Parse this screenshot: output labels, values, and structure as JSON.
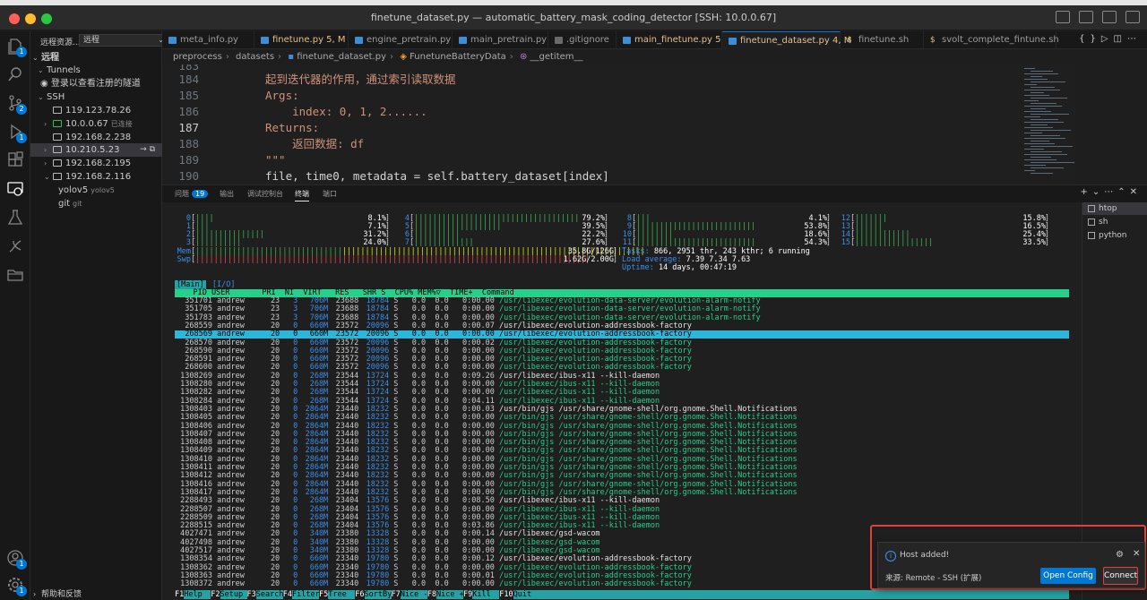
{
  "window": {
    "title": "finetune_dataset.py — automatic_battery_mask_coding_detector [SSH: 10.0.0.67]"
  },
  "activity": {
    "badges": {
      "scm": "2",
      "debug": "1",
      "accounts": "1"
    }
  },
  "sidebar": {
    "title": "远程资源...",
    "select_value": "远程",
    "section_remote": "远程",
    "tunnels_label": "Tunnels",
    "tunnels_login": "登录以查看注册的隧道",
    "ssh_label": "SSH",
    "hosts": [
      {
        "name": "119.123.78.26",
        "sub": ""
      },
      {
        "name": "10.0.0.67",
        "sub": "已连接"
      },
      {
        "name": "192.168.2.238",
        "sub": ""
      },
      {
        "name": "10.210.5.23",
        "sub": ""
      },
      {
        "name": "192.168.2.195",
        "sub": ""
      },
      {
        "name": "192.168.2.116",
        "sub": ""
      }
    ],
    "children": [
      {
        "name": "yolov5",
        "sub": "yolov5"
      },
      {
        "name": "git",
        "sub": "git"
      }
    ],
    "help": "帮助和反馈"
  },
  "tabs": [
    {
      "label": "meta_info.py",
      "status": ""
    },
    {
      "label": "finetune.py",
      "status": "5, M"
    },
    {
      "label": "engine_pretrain.py",
      "status": ""
    },
    {
      "label": "main_pretrain.py",
      "status": ""
    },
    {
      "label": ".gitignore",
      "status": ""
    },
    {
      "label": "main_finetune.py",
      "status": "5"
    },
    {
      "label": "finetune_dataset.py",
      "status": "4, M"
    },
    {
      "label": "finetune.sh",
      "status": ""
    },
    {
      "label": "svolt_complete_fintune.sh",
      "status": ""
    }
  ],
  "breadcrumb": [
    "preprocess",
    "datasets",
    "finetune_dataset.py",
    "FunetuneBatteryData",
    "__getitem__"
  ],
  "code": [
    {
      "ln": "184",
      "text": "起到迭代器的作用，通过索引读取数据",
      "kind": "str"
    },
    {
      "ln": "185",
      "text": "Args:",
      "kind": "str"
    },
    {
      "ln": "186",
      "text": "    index: 0, 1, 2......",
      "kind": "str"
    },
    {
      "ln": "187",
      "text": "Returns:",
      "kind": "str"
    },
    {
      "ln": "188",
      "text": "    返回数据: df",
      "kind": "str"
    },
    {
      "ln": "189",
      "text": "\"\"\"",
      "kind": "str"
    },
    {
      "ln": "190",
      "text": "file, time0, metadata = self.battery_dataset[index]",
      "kind": "code"
    }
  ],
  "panel": {
    "tabs": [
      "问题",
      "输出",
      "调试控制台",
      "终端",
      "端口"
    ],
    "problems_count": "19",
    "terminals": [
      "htop",
      "sh",
      "python"
    ]
  },
  "htop": {
    "cpus": [
      {
        "id": "0",
        "bar": "||||",
        "pct": "8.1%"
      },
      {
        "id": "1",
        "bar": "|||",
        "pct": "7.1%"
      },
      {
        "id": "2",
        "bar": "|||||||||||||||",
        "pct": "31.2%"
      },
      {
        "id": "3",
        "bar": "||||||||||",
        "pct": "24.0%"
      },
      {
        "id": "4",
        "bar": "||||||||||||||||||||||||||||||||||||",
        "pct": "79.2%"
      },
      {
        "id": "5",
        "bar": "|||||||||||||||||||",
        "pct": "39.5%"
      },
      {
        "id": "6",
        "bar": "||||||||||",
        "pct": "22.2%"
      },
      {
        "id": "7",
        "bar": "|||||||||||||",
        "pct": "27.6%"
      },
      {
        "id": "8",
        "bar": "|||",
        "pct": "4.1%"
      },
      {
        "id": "9",
        "bar": "||||||||||||||||||||||||||",
        "pct": "53.8%"
      },
      {
        "id": "10",
        "bar": "||||||||",
        "pct": "18.6%"
      },
      {
        "id": "11",
        "bar": "||||||||||||||||||||||||||",
        "pct": "54.3%"
      },
      {
        "id": "12",
        "bar": "|||||||",
        "pct": "15.8%"
      },
      {
        "id": "13",
        "bar": "||||||",
        "pct": "16.5%"
      },
      {
        "id": "14",
        "bar": "||||||||||||",
        "pct": "25.4%"
      },
      {
        "id": "15",
        "bar": "|||||||||||||||||",
        "pct": "33.5%"
      }
    ],
    "mem_label": "Mem",
    "mem_value": "35.8G/126G",
    "swp_label": "Swp",
    "swp_value": "1.62G/2.00G",
    "tasks_label": "Tasks:",
    "tasks_value": "866, 2951 thr, 243 kthr; 6 running",
    "load_label": "Load average:",
    "load_value": "7.39 7.34 7.63",
    "uptime_label": "Uptime:",
    "uptime_value": "14 days, 00:47:19",
    "tab_main": "[Main]",
    "tab_io": "[I/O]",
    "header": "    PID USER       PRI  NI  VIRT   RES   SHR S  CPU% MEM%▽  TIME+  Command",
    "processes": [
      {
        "pid": "351701",
        "pri": "23",
        "ni": "3",
        "virt": "706M",
        "res": "23688",
        "shr": "18784",
        "time": "0:00.00",
        "cmd": "/usr/libexec/evolution-data-server/evolution-alarm-notify",
        "c": "g"
      },
      {
        "pid": "351705",
        "pri": "23",
        "ni": "3",
        "virt": "706M",
        "res": "23688",
        "shr": "18784",
        "time": "0:00.00",
        "cmd": "/usr/libexec/evolution-data-server/evolution-alarm-notify",
        "c": "g"
      },
      {
        "pid": "351783",
        "pri": "23",
        "ni": "3",
        "virt": "706M",
        "res": "23688",
        "shr": "18784",
        "time": "0:00.00",
        "cmd": "/usr/libexec/evolution-data-server/evolution-alarm-notify",
        "c": "g"
      },
      {
        "pid": "268559",
        "pri": "20",
        "ni": "0",
        "virt": "660M",
        "res": "23572",
        "shr": "20096",
        "time": "0:00.07",
        "cmd": "/usr/libexec/evolution-addressbook-factory",
        "c": "w"
      },
      {
        "pid": "268569",
        "pri": "20",
        "ni": "0",
        "virt": "660M",
        "res": "23572",
        "shr": "20096",
        "time": "0:00.00",
        "cmd": "/usr/libexec/evolution-addressbook-factory",
        "c": "g",
        "sel": true
      },
      {
        "pid": "268570",
        "pri": "20",
        "ni": "0",
        "virt": "660M",
        "res": "23572",
        "shr": "20096",
        "time": "0:00.02",
        "cmd": "/usr/libexec/evolution-addressbook-factory",
        "c": "g"
      },
      {
        "pid": "268590",
        "pri": "20",
        "ni": "0",
        "virt": "660M",
        "res": "23572",
        "shr": "20096",
        "time": "0:00.00",
        "cmd": "/usr/libexec/evolution-addressbook-factory",
        "c": "g"
      },
      {
        "pid": "268591",
        "pri": "20",
        "ni": "0",
        "virt": "660M",
        "res": "23572",
        "shr": "20096",
        "time": "0:00.00",
        "cmd": "/usr/libexec/evolution-addressbook-factory",
        "c": "g"
      },
      {
        "pid": "268600",
        "pri": "20",
        "ni": "0",
        "virt": "660M",
        "res": "23572",
        "shr": "20096",
        "time": "0:00.00",
        "cmd": "/usr/libexec/evolution-addressbook-factory",
        "c": "g"
      },
      {
        "pid": "1308269",
        "pri": "20",
        "ni": "0",
        "virt": "268M",
        "res": "23544",
        "shr": "13724",
        "time": "0:09.26",
        "cmd": "/usr/libexec/ibus-x11 --kill-daemon",
        "c": "w"
      },
      {
        "pid": "1308280",
        "pri": "20",
        "ni": "0",
        "virt": "268M",
        "res": "23544",
        "shr": "13724",
        "time": "0:00.00",
        "cmd": "/usr/libexec/ibus-x11 --kill-daemon",
        "c": "g"
      },
      {
        "pid": "1308282",
        "pri": "20",
        "ni": "0",
        "virt": "268M",
        "res": "23544",
        "shr": "13724",
        "time": "0:00.00",
        "cmd": "/usr/libexec/ibus-x11 --kill-daemon",
        "c": "g"
      },
      {
        "pid": "1308284",
        "pri": "20",
        "ni": "0",
        "virt": "268M",
        "res": "23544",
        "shr": "13724",
        "time": "0:04.11",
        "cmd": "/usr/libexec/ibus-x11 --kill-daemon",
        "c": "g"
      },
      {
        "pid": "1308403",
        "pri": "20",
        "ni": "0",
        "virt": "2864M",
        "res": "23440",
        "shr": "18232",
        "time": "0:00.03",
        "cmd": "/usr/bin/gjs /usr/share/gnome-shell/org.gnome.Shell.Notifications",
        "c": "w"
      },
      {
        "pid": "1308405",
        "pri": "20",
        "ni": "0",
        "virt": "2864M",
        "res": "23440",
        "shr": "18232",
        "time": "0:00.00",
        "cmd": "/usr/bin/gjs /usr/share/gnome-shell/org.gnome.Shell.Notifications",
        "c": "g"
      },
      {
        "pid": "1308406",
        "pri": "20",
        "ni": "0",
        "virt": "2864M",
        "res": "23440",
        "shr": "18232",
        "time": "0:00.00",
        "cmd": "/usr/bin/gjs /usr/share/gnome-shell/org.gnome.Shell.Notifications",
        "c": "g"
      },
      {
        "pid": "1308407",
        "pri": "20",
        "ni": "0",
        "virt": "2864M",
        "res": "23440",
        "shr": "18232",
        "time": "0:00.00",
        "cmd": "/usr/bin/gjs /usr/share/gnome-shell/org.gnome.Shell.Notifications",
        "c": "g"
      },
      {
        "pid": "1308408",
        "pri": "20",
        "ni": "0",
        "virt": "2864M",
        "res": "23440",
        "shr": "18232",
        "time": "0:00.00",
        "cmd": "/usr/bin/gjs /usr/share/gnome-shell/org.gnome.Shell.Notifications",
        "c": "g"
      },
      {
        "pid": "1308409",
        "pri": "20",
        "ni": "0",
        "virt": "2864M",
        "res": "23440",
        "shr": "18232",
        "time": "0:00.00",
        "cmd": "/usr/bin/gjs /usr/share/gnome-shell/org.gnome.Shell.Notifications",
        "c": "g"
      },
      {
        "pid": "1308410",
        "pri": "20",
        "ni": "0",
        "virt": "2864M",
        "res": "23440",
        "shr": "18232",
        "time": "0:00.00",
        "cmd": "/usr/bin/gjs /usr/share/gnome-shell/org.gnome.Shell.Notifications",
        "c": "g"
      },
      {
        "pid": "1308411",
        "pri": "20",
        "ni": "0",
        "virt": "2864M",
        "res": "23440",
        "shr": "18232",
        "time": "0:00.00",
        "cmd": "/usr/bin/gjs /usr/share/gnome-shell/org.gnome.Shell.Notifications",
        "c": "g"
      },
      {
        "pid": "1308412",
        "pri": "20",
        "ni": "0",
        "virt": "2864M",
        "res": "23440",
        "shr": "18232",
        "time": "0:00.00",
        "cmd": "/usr/bin/gjs /usr/share/gnome-shell/org.gnome.Shell.Notifications",
        "c": "g"
      },
      {
        "pid": "1308416",
        "pri": "20",
        "ni": "0",
        "virt": "2864M",
        "res": "23440",
        "shr": "18232",
        "time": "0:00.00",
        "cmd": "/usr/bin/gjs /usr/share/gnome-shell/org.gnome.Shell.Notifications",
        "c": "g"
      },
      {
        "pid": "1308417",
        "pri": "20",
        "ni": "0",
        "virt": "2864M",
        "res": "23440",
        "shr": "18232",
        "time": "0:00.00",
        "cmd": "/usr/bin/gjs /usr/share/gnome-shell/org.gnome.Shell.Notifications",
        "c": "g"
      },
      {
        "pid": "2288493",
        "pri": "20",
        "ni": "0",
        "virt": "268M",
        "res": "23404",
        "shr": "13576",
        "time": "0:08.50",
        "cmd": "/usr/libexec/ibus-x11 --kill-daemon",
        "c": "w"
      },
      {
        "pid": "2288507",
        "pri": "20",
        "ni": "0",
        "virt": "268M",
        "res": "23404",
        "shr": "13576",
        "time": "0:00.00",
        "cmd": "/usr/libexec/ibus-x11 --kill-daemon",
        "c": "g"
      },
      {
        "pid": "2288509",
        "pri": "20",
        "ni": "0",
        "virt": "268M",
        "res": "23404",
        "shr": "13576",
        "time": "0:00.00",
        "cmd": "/usr/libexec/ibus-x11 --kill-daemon",
        "c": "g"
      },
      {
        "pid": "2288515",
        "pri": "20",
        "ni": "0",
        "virt": "268M",
        "res": "23404",
        "shr": "13576",
        "time": "0:03.86",
        "cmd": "/usr/libexec/ibus-x11 --kill-daemon",
        "c": "g"
      },
      {
        "pid": "4027471",
        "pri": "20",
        "ni": "0",
        "virt": "340M",
        "res": "23380",
        "shr": "13328",
        "time": "0:00.14",
        "cmd": "/usr/libexec/gsd-wacom",
        "c": "w"
      },
      {
        "pid": "4027498",
        "pri": "20",
        "ni": "0",
        "virt": "340M",
        "res": "23380",
        "shr": "13328",
        "time": "0:00.00",
        "cmd": "/usr/libexec/gsd-wacom",
        "c": "g"
      },
      {
        "pid": "4027517",
        "pri": "20",
        "ni": "0",
        "virt": "340M",
        "res": "23380",
        "shr": "13328",
        "time": "0:00.00",
        "cmd": "/usr/libexec/gsd-wacom",
        "c": "g"
      },
      {
        "pid": "1308354",
        "pri": "20",
        "ni": "0",
        "virt": "660M",
        "res": "23340",
        "shr": "19780",
        "time": "0:00.12",
        "cmd": "/usr/libexec/evolution-addressbook-factory",
        "c": "w"
      },
      {
        "pid": "1308362",
        "pri": "20",
        "ni": "0",
        "virt": "660M",
        "res": "23340",
        "shr": "19780",
        "time": "0:00.00",
        "cmd": "/usr/libexec/evolution-addressbook-factory",
        "c": "g"
      },
      {
        "pid": "1308363",
        "pri": "20",
        "ni": "0",
        "virt": "660M",
        "res": "23340",
        "shr": "19780",
        "time": "0:00.01",
        "cmd": "/usr/libexec/evolution-addressbook-factory",
        "c": "g"
      },
      {
        "pid": "1308372",
        "pri": "20",
        "ni": "0",
        "virt": "660M",
        "res": "23340",
        "shr": "19780",
        "time": "0:00.00",
        "cmd": "/usr/libexec/evolution-addressbook-factory",
        "c": "g"
      }
    ],
    "fkeys": [
      {
        "k": "F1",
        "l": "Help"
      },
      {
        "k": "F2",
        "l": "Setup"
      },
      {
        "k": "F3",
        "l": "Search"
      },
      {
        "k": "F4",
        "l": "Filter"
      },
      {
        "k": "F5",
        "l": "Tree"
      },
      {
        "k": "F6",
        "l": "SortBy"
      },
      {
        "k": "F7",
        "l": "Nice -"
      },
      {
        "k": "F8",
        "l": "Nice +"
      },
      {
        "k": "F9",
        "l": "Kill"
      },
      {
        "k": "F10",
        "l": "Quit"
      }
    ]
  },
  "notification": {
    "message": "Host added!",
    "source": "来源: Remote - SSH (扩展)",
    "open_config": "Open Config",
    "connect": "Connect"
  }
}
